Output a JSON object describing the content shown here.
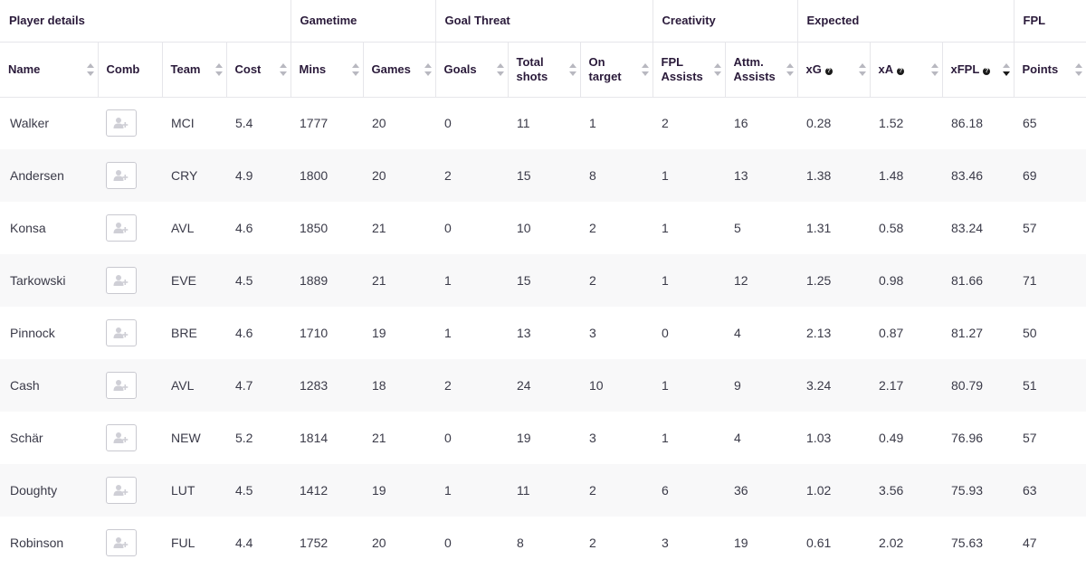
{
  "groups": {
    "player_details": "Player details",
    "gametime": "Gametime",
    "goal_threat": "Goal Threat",
    "creativity": "Creativity",
    "expected": "Expected",
    "fpl": "FPL"
  },
  "columns": {
    "name": "Name",
    "comb": "Comb",
    "team": "Team",
    "cost": "Cost",
    "mins": "Mins",
    "games": "Games",
    "goals": "Goals",
    "total_shots_1": "Total",
    "total_shots_2": "shots",
    "on_target_1": "On",
    "on_target_2": "target",
    "fpl_assists_1": "FPL",
    "fpl_assists_2": "Assists",
    "attm_assists_1": "Attm.",
    "attm_assists_2": "Assists",
    "xg": "xG",
    "xa": "xA",
    "xfpl": "xFPL",
    "points": "Points",
    "info_glyph": "?"
  },
  "sort": {
    "column": "xFPL",
    "direction": "descending"
  },
  "colors": {
    "header_text": "#2a1a3a",
    "body_text": "#3a3a48",
    "row_alt_bg": "#f8f8f9",
    "border": "#e6e6ea"
  },
  "icons": {
    "sort": "sort-arrows-icon",
    "info": "question-circle-icon",
    "add_player": "add-user-icon"
  },
  "rows": [
    [
      "Walker",
      "MCI",
      "5.4",
      "1777",
      "20",
      "0",
      "11",
      "1",
      "2",
      "16",
      "0.28",
      "1.52",
      "86.18",
      "65"
    ],
    [
      "Andersen",
      "CRY",
      "4.9",
      "1800",
      "20",
      "2",
      "15",
      "8",
      "1",
      "13",
      "1.38",
      "1.48",
      "83.46",
      "69"
    ],
    [
      "Konsa",
      "AVL",
      "4.6",
      "1850",
      "21",
      "0",
      "10",
      "2",
      "1",
      "5",
      "1.31",
      "0.58",
      "83.24",
      "57"
    ],
    [
      "Tarkowski",
      "EVE",
      "4.5",
      "1889",
      "21",
      "1",
      "15",
      "2",
      "1",
      "12",
      "1.25",
      "0.98",
      "81.66",
      "71"
    ],
    [
      "Pinnock",
      "BRE",
      "4.6",
      "1710",
      "19",
      "1",
      "13",
      "3",
      "0",
      "4",
      "2.13",
      "0.87",
      "81.27",
      "50"
    ],
    [
      "Cash",
      "AVL",
      "4.7",
      "1283",
      "18",
      "2",
      "24",
      "10",
      "1",
      "9",
      "3.24",
      "2.17",
      "80.79",
      "51"
    ],
    [
      "Schär",
      "NEW",
      "5.2",
      "1814",
      "21",
      "0",
      "19",
      "3",
      "1",
      "4",
      "1.03",
      "0.49",
      "76.96",
      "57"
    ],
    [
      "Doughty",
      "LUT",
      "4.5",
      "1412",
      "19",
      "1",
      "11",
      "2",
      "6",
      "36",
      "1.02",
      "3.56",
      "75.93",
      "63"
    ],
    [
      "Robinson",
      "FUL",
      "4.4",
      "1752",
      "20",
      "0",
      "8",
      "2",
      "3",
      "19",
      "0.61",
      "2.02",
      "75.63",
      "47"
    ]
  ]
}
